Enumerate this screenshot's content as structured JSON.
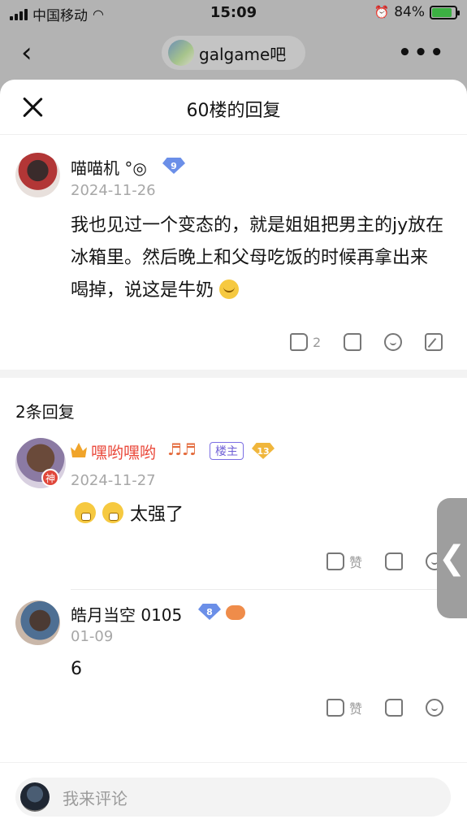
{
  "status_bar": {
    "carrier": "中国移动",
    "time": "15:09",
    "battery_pct": "84%",
    "battery_level": 0.84
  },
  "nav": {
    "forum_name": "galgame吧",
    "more_glyph": "•••"
  },
  "sheet": {
    "title": "60楼的回复"
  },
  "main_post": {
    "username": "喵喵机 °◎",
    "level": "9",
    "date": "2024-11-26",
    "content": "我也见过一个变态的，就是姐姐把男主的jy放在冰箱里。然后晚上和父母吃饭的时候再拿出来喝掉，说这是牛奶",
    "like_count": "2"
  },
  "replies_header": "2条回复",
  "replies": [
    {
      "username": "嘿哟嘿哟",
      "music_notes": "♬♬",
      "badge_op": "楼主",
      "level": "13",
      "god_badge": "神",
      "date": "2024-11-27",
      "content": "太强了",
      "like_label": "赞"
    },
    {
      "username": "皓月当空 0105",
      "level": "8",
      "date": "01-09",
      "content": "6",
      "like_label": "赞"
    }
  ],
  "side_handle_glyph": "❮",
  "comment_bar": {
    "placeholder": "我来评论"
  },
  "colors": {
    "accent_red": "#ea4a3c",
    "op_badge": "#6f5fd6",
    "level_gem": "#6b8fe8",
    "level_gem_orange": "#f0b63c"
  }
}
